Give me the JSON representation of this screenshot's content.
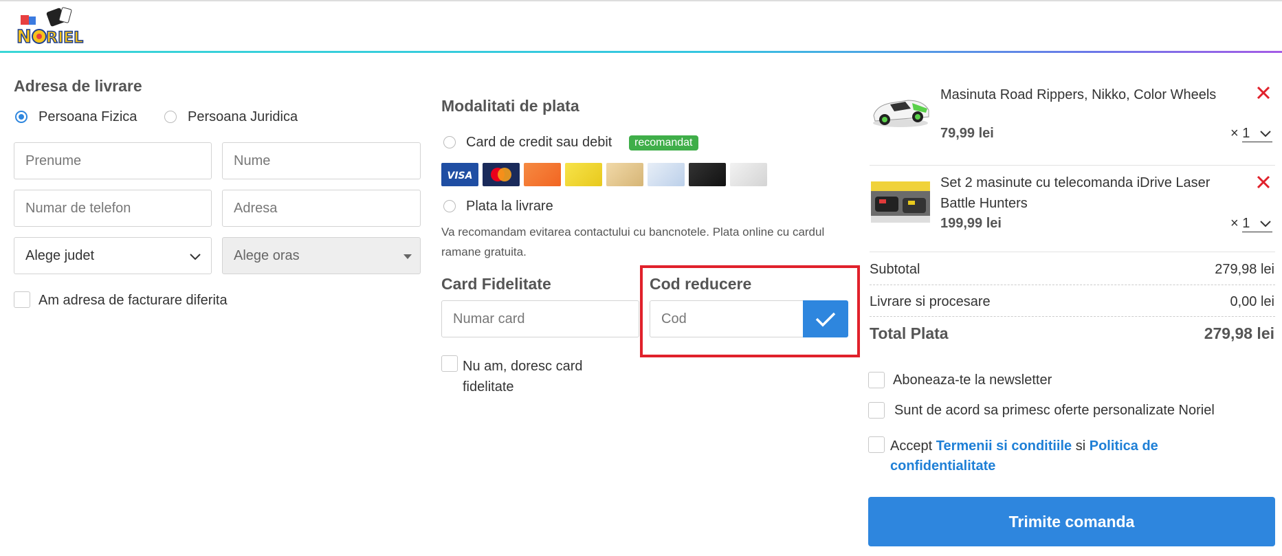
{
  "address": {
    "title": "Adresa de livrare",
    "person_types": [
      {
        "label": "Persoana Fizica",
        "selected": true
      },
      {
        "label": "Persoana Juridica",
        "selected": false
      }
    ],
    "first_name_placeholder": "Prenume",
    "last_name_placeholder": "Nume",
    "phone_placeholder": "Numar de telefon",
    "address_placeholder": "Adresa",
    "county_select": "Alege judet",
    "city_select": "Alege oras",
    "billing_diff_label": "Am adresa de facturare diferita"
  },
  "payment": {
    "title": "Modalitati de plata",
    "card_option": "Card de credit sau debit",
    "recommended_badge": "recomandat",
    "cash_option": "Plata la livrare",
    "note": "Va recomandam evitarea contactului cu bancnotele. Plata online cu cardul ramane gratuita.",
    "card_logos": [
      "visa-card-icon",
      "mastercard-icon",
      "card-logo-3",
      "card-logo-4",
      "card-logo-5",
      "card-logo-6",
      "card-logo-7",
      "card-logo-8"
    ]
  },
  "loyalty": {
    "title": "Card Fidelitate",
    "placeholder": "Numar card",
    "no_card_label": "Nu am, doresc card fidelitate"
  },
  "discount": {
    "title": "Cod reducere",
    "placeholder": "Cod"
  },
  "cart": {
    "items": [
      {
        "name": "Masinuta Road Rippers, Nikko, Color Wheels",
        "price": "79,99 lei",
        "qty_prefix": "×",
        "qty": "1"
      },
      {
        "name": "Set 2 masinute cu telecomanda iDrive Laser Battle Hunters",
        "price": "199,99 lei",
        "qty_prefix": "×",
        "qty": "1"
      }
    ],
    "subtotal_label": "Subtotal",
    "subtotal_value": "279,98 lei",
    "shipping_label": "Livrare si procesare",
    "shipping_value": "0,00 lei",
    "total_label": "Total Plata",
    "total_value": "279,98 lei",
    "newsletter_label": "Aboneaza-te la newsletter",
    "offers_label": "Sunt de acord sa primesc oferte personalizate Noriel",
    "accept_prefix": "Accept",
    "terms_link": "Termenii si conditiile",
    "accept_and": "si",
    "privacy_link": "Politica de confidentialitate",
    "submit_label": "Trimite comanda"
  },
  "colors": {
    "accent": "#2e86de",
    "badge": "#3fae49",
    "highlight": "#e0212b",
    "remove": "#e0212b"
  }
}
